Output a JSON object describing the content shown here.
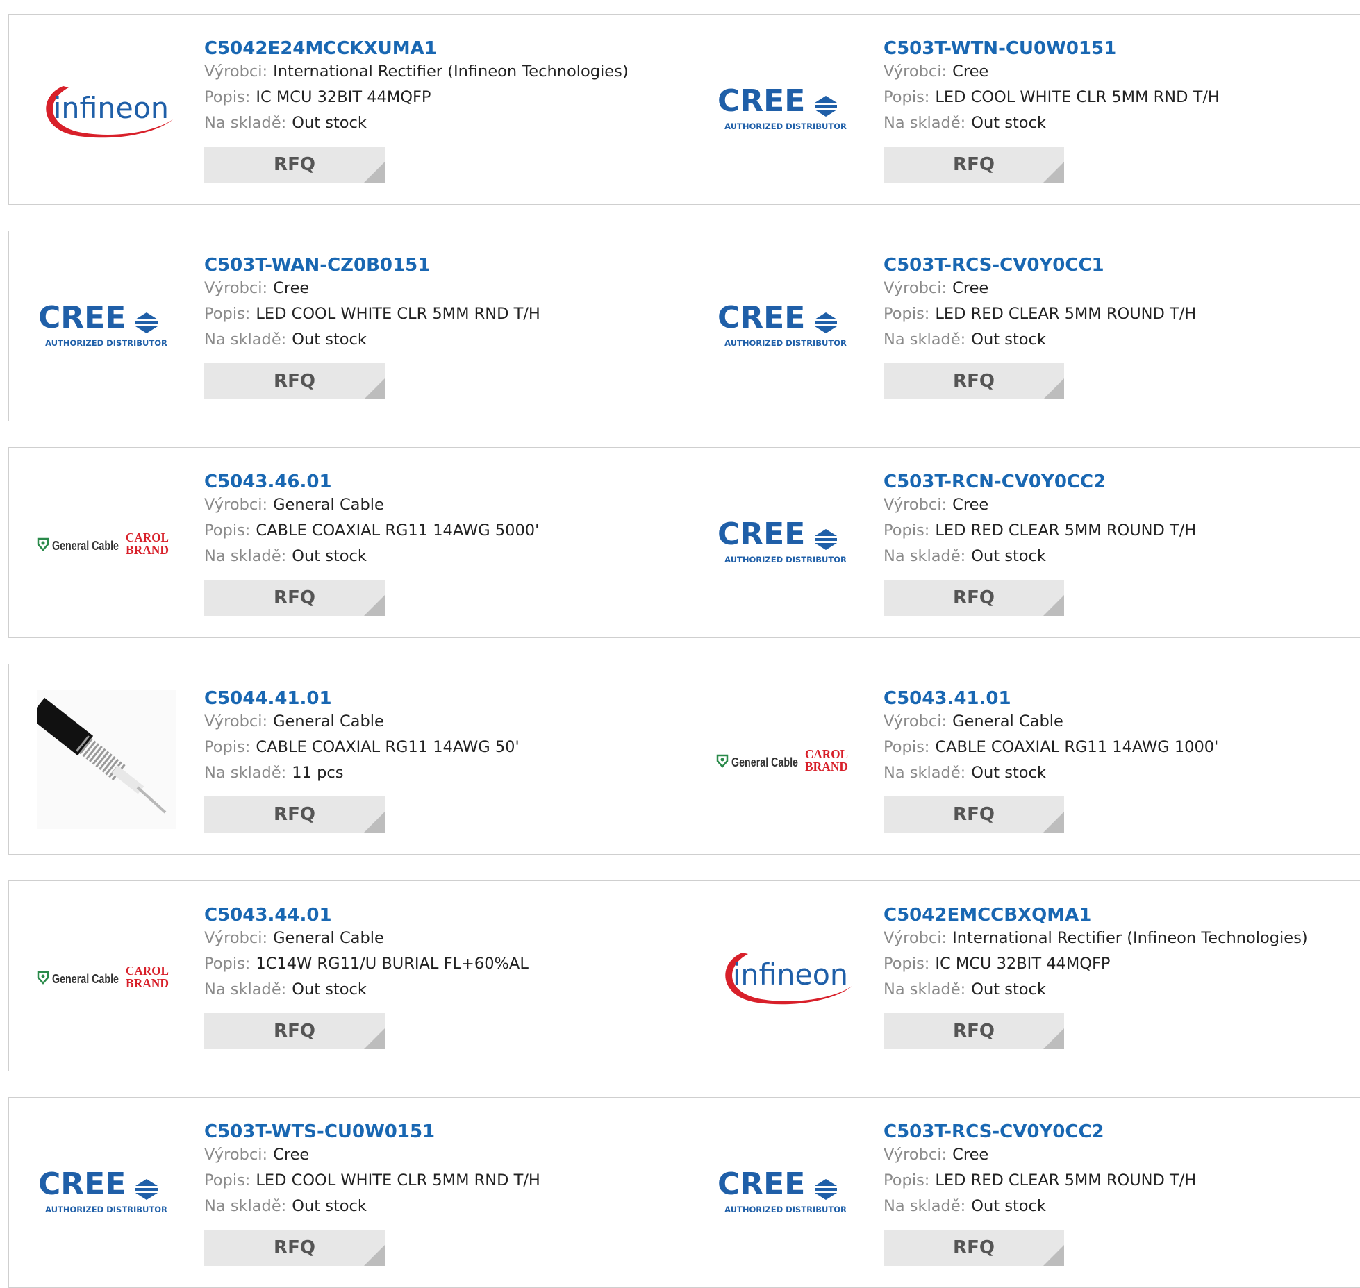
{
  "labels": {
    "manufacturer": "Výrobci:",
    "description": "Popis:",
    "stock": "Na skladě:",
    "rfq": "RFQ"
  },
  "brands": {
    "cree": {
      "wordmark": "CREE",
      "tagline": "AUTHORIZED DISTRIBUTOR",
      "color": "#1f5fa8"
    },
    "infineon": {
      "wordmark": "infineon",
      "color": "#1f5fa8",
      "swoosh": "#d8202a"
    },
    "general_cable": {
      "wordmark": "General Cable",
      "carol_top": "CAROL",
      "carol_bottom": "BRAND",
      "green": "#2a8a4a",
      "red": "#d8202a"
    }
  },
  "products": [
    {
      "part": "C5042E24MCCKXUMA1",
      "logo": "infineon",
      "manufacturer": "International Rectifier (Infineon Technologies)",
      "description": "IC MCU 32BIT 44MQFP",
      "stock": "Out stock"
    },
    {
      "part": "C503T-WTN-CU0W0151",
      "logo": "cree",
      "manufacturer": "Cree",
      "description": "LED COOL WHITE CLR 5MM RND T/H",
      "stock": "Out stock"
    },
    {
      "part": "C503T-WAN-CZ0B0151",
      "logo": "cree",
      "manufacturer": "Cree",
      "description": "LED COOL WHITE CLR 5MM RND T/H",
      "stock": "Out stock"
    },
    {
      "part": "C503T-RCS-CV0Y0CC1",
      "logo": "cree",
      "manufacturer": "Cree",
      "description": "LED RED CLEAR 5MM ROUND T/H",
      "stock": "Out stock"
    },
    {
      "part": "C5043.46.01",
      "logo": "general_cable",
      "manufacturer": "General Cable",
      "description": "CABLE COAXIAL RG11 14AWG 5000'",
      "stock": "Out stock"
    },
    {
      "part": "C503T-RCN-CV0Y0CC2",
      "logo": "cree",
      "manufacturer": "Cree",
      "description": "LED RED CLEAR 5MM ROUND T/H",
      "stock": "Out stock"
    },
    {
      "part": "C5044.41.01",
      "logo": "cable_photo",
      "manufacturer": "General Cable",
      "description": "CABLE COAXIAL RG11 14AWG 50'",
      "stock": "11 pcs"
    },
    {
      "part": "C5043.41.01",
      "logo": "general_cable",
      "manufacturer": "General Cable",
      "description": "CABLE COAXIAL RG11 14AWG 1000'",
      "stock": "Out stock"
    },
    {
      "part": "C5043.44.01",
      "logo": "general_cable",
      "manufacturer": "General Cable",
      "description": "1C14W RG11/U BURIAL FL+60%AL",
      "stock": "Out stock"
    },
    {
      "part": "C5042EMCCBXQMA1",
      "logo": "infineon",
      "manufacturer": "International Rectifier (Infineon Technologies)",
      "description": "IC MCU 32BIT 44MQFP",
      "stock": "Out stock"
    },
    {
      "part": "C503T-WTS-CU0W0151",
      "logo": "cree",
      "manufacturer": "Cree",
      "description": "LED COOL WHITE CLR 5MM RND T/H",
      "stock": "Out stock"
    },
    {
      "part": "C503T-RCS-CV0Y0CC2",
      "logo": "cree",
      "manufacturer": "Cree",
      "description": "LED RED CLEAR 5MM ROUND T/H",
      "stock": "Out stock"
    }
  ]
}
